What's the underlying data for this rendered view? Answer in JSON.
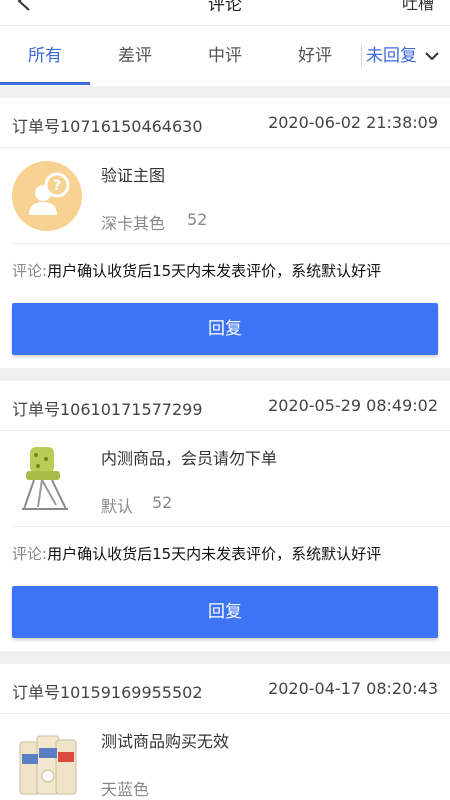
{
  "header": {
    "title": "评论",
    "right": "吐槽"
  },
  "tabs": [
    {
      "label": "所有",
      "active": true
    },
    {
      "label": "差评",
      "active": false
    },
    {
      "label": "中评",
      "active": false
    },
    {
      "label": "好评",
      "active": false
    }
  ],
  "filter": {
    "label": "未回复",
    "icon": "chevron-down-icon"
  },
  "colors": {
    "accent": "#3f6ad8",
    "button": "#3d73f5",
    "avatar_bg": "#f7d293"
  },
  "comment_label": "评论:",
  "reply_label": "回复",
  "orders": [
    {
      "order_no": "订单号10716150464630",
      "time": "2020-06-02 21:38:09",
      "thumb": "question-avatar-icon",
      "product": "验证主图",
      "spec": "深卡其色",
      "qty": "52",
      "comment": "用户确认收货后15天内未发表评价，系统默认好评"
    },
    {
      "order_no": "订单号10610171577299",
      "time": "2020-05-29 08:49:02",
      "thumb": "high-chair-image",
      "product": "内测商品，会员请勿下单",
      "spec": "默认",
      "qty": "52",
      "comment": "用户确认收货后15天内未发表评价，系统默认好评"
    },
    {
      "order_no": "订单号10159169955502",
      "time": "2020-04-17 08:20:43",
      "thumb": "milk-cans-image",
      "product": "测试商品购买无效",
      "spec": "天蓝色",
      "qty": "",
      "comment": ""
    }
  ]
}
